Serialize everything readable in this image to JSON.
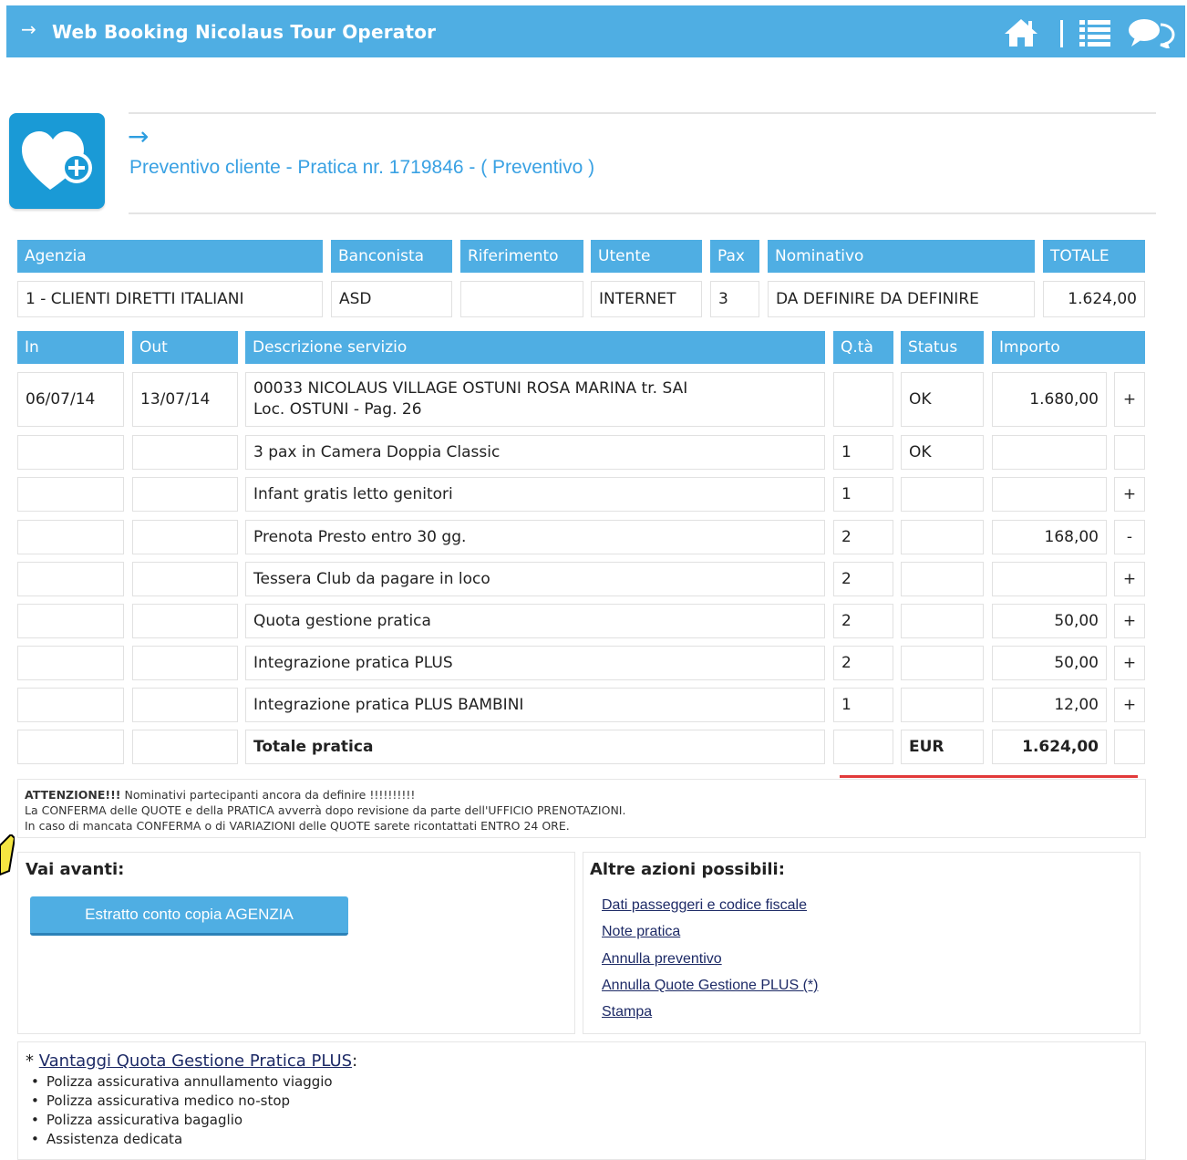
{
  "topbar": {
    "title": "Web Booking Nicolaus Tour Operator",
    "icons": [
      "home-icon",
      "list-icon",
      "chat-icon"
    ],
    "color": "#4faee3"
  },
  "header": {
    "title": "Preventivo cliente - Pratica nr. 1719846 - ( Preventivo )",
    "icon": "heart-plus-icon"
  },
  "summary": {
    "headers": [
      "Agenzia",
      "Banconista",
      "Riferimento",
      "Utente",
      "Pax",
      "Nominativo",
      "TOTALE"
    ],
    "values": [
      "1 - CLIENTI DIRETTI ITALIANI",
      "ASD",
      "",
      "INTERNET",
      "3",
      "DA DEFINIRE DA DEFINIRE",
      "1.624,00"
    ]
  },
  "services": {
    "headers": [
      "In",
      "Out",
      "Descrizione servizio",
      "Q.tà",
      "Status",
      "Importo"
    ],
    "rows": [
      {
        "in": "06/07/14",
        "out": "13/07/14",
        "desc1": "00033 NICOLAUS VILLAGE OSTUNI ROSA MARINA tr. SAI",
        "desc2": "Loc. OSTUNI - Pag. 26",
        "qty": "",
        "status": "OK",
        "amount": "1.680,00",
        "sign": "+"
      },
      {
        "in": "",
        "out": "",
        "desc1": "3 pax in Camera Doppia Classic",
        "desc2": "",
        "qty": "1",
        "status": "OK",
        "amount": "",
        "sign": ""
      },
      {
        "in": "",
        "out": "",
        "desc1": "Infant gratis letto genitori",
        "desc2": "",
        "qty": "1",
        "status": "",
        "amount": "",
        "sign": "+"
      },
      {
        "in": "",
        "out": "",
        "desc1": "Prenota Presto entro 30 gg.",
        "desc2": "",
        "qty": "2",
        "status": "",
        "amount": "168,00",
        "sign": "-"
      },
      {
        "in": "",
        "out": "",
        "desc1": "Tessera Club da pagare in loco",
        "desc2": "",
        "qty": "2",
        "status": "",
        "amount": "",
        "sign": "+"
      },
      {
        "in": "",
        "out": "",
        "desc1": "Quota gestione pratica",
        "desc2": "",
        "qty": "2",
        "status": "",
        "amount": "50,00",
        "sign": "+"
      },
      {
        "in": "",
        "out": "",
        "desc1": "Integrazione pratica PLUS",
        "desc2": "",
        "qty": "2",
        "status": "",
        "amount": "50,00",
        "sign": "+"
      },
      {
        "in": "",
        "out": "",
        "desc1": "Integrazione pratica PLUS BAMBINI",
        "desc2": "",
        "qty": "1",
        "status": "",
        "amount": "12,00",
        "sign": "+"
      }
    ],
    "total": {
      "label": "Totale pratica",
      "currency": "EUR",
      "amount": "1.624,00"
    }
  },
  "notice": {
    "attention_bold": "ATTENZIONE!!!",
    "attention_rest": " Nominativi partecipanti ancora da definire !!!!!!!!!!",
    "line2": "La CONFERMA delle QUOTE e della PRATICA avverrà dopo revisione da parte dell'UFFICIO PRENOTAZIONI.",
    "line3": "In caso di mancata CONFERMA o di VARIAZIONI delle QUOTE sarete ricontattati ENTRO 24 ORE."
  },
  "next": {
    "title": "Vai avanti:",
    "button": "Estratto conto copia AGENZIA"
  },
  "other": {
    "title": "Altre azioni possibili:",
    "links": [
      "Dati passeggeri e codice fiscale",
      "Note pratica",
      "Annulla preventivo",
      "Annulla Quote Gestione PLUS (*)",
      "Stampa"
    ]
  },
  "footnote": {
    "prefix": "* ",
    "title": "Vantaggi Quota Gestione Pratica PLUS",
    "suffix": ":",
    "items": [
      "Polizza assicurativa annullamento viaggio",
      "Polizza assicurativa medico no-stop",
      "Polizza assicurativa bagaglio",
      "Assistenza dedicata"
    ]
  }
}
